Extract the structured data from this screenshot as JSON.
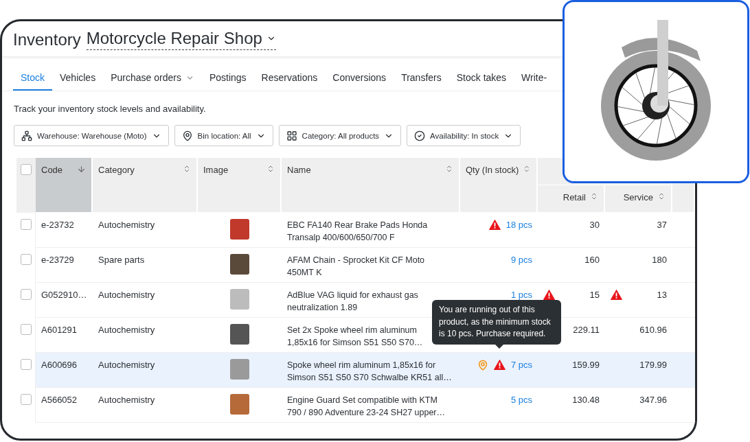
{
  "header": {
    "title": "Inventory",
    "shop": "Motorcycle Repair Shop"
  },
  "tabs": [
    {
      "label": "Stock",
      "selected": true,
      "has_menu": false
    },
    {
      "label": "Vehicles",
      "selected": false,
      "has_menu": false
    },
    {
      "label": "Purchase orders",
      "selected": false,
      "has_menu": true
    },
    {
      "label": "Postings",
      "selected": false,
      "has_menu": false
    },
    {
      "label": "Reservations",
      "selected": false,
      "has_menu": false
    },
    {
      "label": "Conversions",
      "selected": false,
      "has_menu": false
    },
    {
      "label": "Transfers",
      "selected": false,
      "has_menu": false
    },
    {
      "label": "Stock takes",
      "selected": false,
      "has_menu": false
    },
    {
      "label": "Write-",
      "selected": false,
      "has_menu": false
    }
  ],
  "description": "Track your inventory stock levels and availability.",
  "filters": [
    {
      "kind": "warehouse",
      "label": "Warehouse: Warehouse (Moto)"
    },
    {
      "kind": "location",
      "label": "Bin location: All"
    },
    {
      "kind": "category",
      "label": "Category: All products"
    },
    {
      "kind": "availability",
      "label": "Availability: In stock"
    }
  ],
  "table": {
    "select_all_checked": false,
    "columns": [
      {
        "label": "Code",
        "sorted": true
      },
      {
        "label": "Category",
        "sorted": false
      },
      {
        "label": "Image",
        "sorted": false
      },
      {
        "label": "Name",
        "sorted": false
      },
      {
        "label": "Qty (In stock)",
        "sorted": false
      }
    ],
    "price_columns": [
      {
        "label": "Retail",
        "sorted": false
      },
      {
        "label": "Service",
        "sorted": false
      }
    ],
    "rows": [
      {
        "code": "e-23732",
        "category": "Autochemistry",
        "name": [
          "EBC FA140 Rear Brake Pads Honda",
          "Transalp 400/600/650/700 F"
        ],
        "qty": "18 pcs",
        "qty_warning": true,
        "location_flag": false,
        "retail": "30",
        "retail_warning": false,
        "service": "37",
        "service_warning": false,
        "selected": false,
        "checked": false
      },
      {
        "code": "e-23729",
        "category": "Spare parts",
        "name": [
          "AFAM Chain - Sprocket Kit CF Moto",
          "450MT K"
        ],
        "qty": "9 pcs",
        "qty_warning": false,
        "location_flag": false,
        "retail": "160",
        "retail_warning": false,
        "service": "180",
        "service_warning": false,
        "selected": false,
        "checked": false
      },
      {
        "code": "G052910…",
        "category": "Autochemistry",
        "name": [
          "AdBlue VAG liquid for exhaust gas",
          "neutralization 1.89"
        ],
        "qty": "1 pcs",
        "qty_warning": false,
        "location_flag": false,
        "retail": "15",
        "retail_warning": true,
        "service": "13",
        "service_warning": true,
        "selected": false,
        "checked": false
      },
      {
        "code": "A601291",
        "category": "Autochemistry",
        "name": [
          "Set 2x Spoke wheel rim aluminum",
          "1,85x16 for Simson S51 S50 S70…"
        ],
        "qty": "",
        "qty_warning": false,
        "location_flag": false,
        "retail": "229.11",
        "retail_warning": false,
        "service": "610.96",
        "service_warning": false,
        "selected": false,
        "checked": false
      },
      {
        "code": "A600696",
        "category": "Autochemistry",
        "name": [
          "Spoke wheel rim aluminum 1,85x16 for",
          "Simson S51 S50 S70 Schwalbe KR51 all…"
        ],
        "qty": "7 pcs",
        "qty_warning": true,
        "location_flag": true,
        "retail": "159.99",
        "retail_warning": false,
        "service": "179.99",
        "service_warning": false,
        "selected": true,
        "checked": false
      },
      {
        "code": "A566052",
        "category": "Autochemistry",
        "name": [
          "Engine Guard Set compatible with KTM",
          "790 / 890 Adventure 23-24 SH27 upper…"
        ],
        "qty": "5 pcs",
        "qty_warning": false,
        "location_flag": false,
        "retail": "130.48",
        "retail_warning": false,
        "service": "347.96",
        "service_warning": false,
        "selected": false,
        "checked": false
      }
    ]
  },
  "tooltip": {
    "text": "You are running out of this product, as the minimum stock is 10 pcs. Purchase required."
  }
}
